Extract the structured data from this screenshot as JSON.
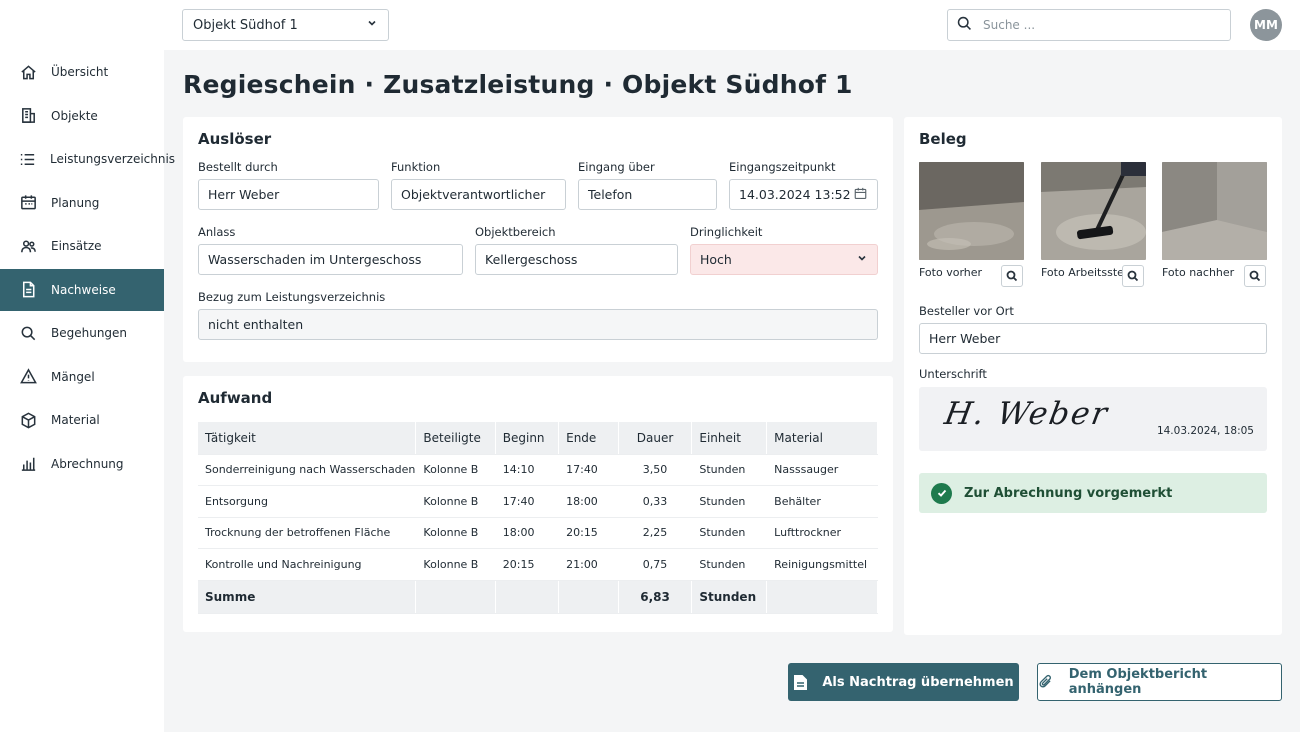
{
  "sidebar": {
    "items": [
      {
        "label": "Übersicht",
        "icon": "home-icon"
      },
      {
        "label": "Objekte",
        "icon": "building-icon"
      },
      {
        "label": "Leistungsverzeichnis",
        "icon": "list-icon"
      },
      {
        "label": "Planung",
        "icon": "calendar-icon"
      },
      {
        "label": "Einsätze",
        "icon": "team-icon"
      },
      {
        "label": "Nachweise",
        "icon": "document-icon",
        "active": true
      },
      {
        "label": "Begehungen",
        "icon": "search-icon"
      },
      {
        "label": "Mängel",
        "icon": "warning-icon"
      },
      {
        "label": "Material",
        "icon": "box-icon"
      },
      {
        "label": "Abrechnung",
        "icon": "bar-chart-icon"
      }
    ]
  },
  "topbar": {
    "object_select": "Objekt Südhof 1",
    "search_placeholder": "Suche ...",
    "avatar_initials": "MM"
  },
  "page": {
    "title": "Regieschein · Zusatzleistung · Objekt Südhof 1"
  },
  "trigger": {
    "heading": "Auslöser",
    "ordered_by_label": "Bestellt durch",
    "ordered_by_value": "Herr Weber",
    "function_label": "Funktion",
    "function_value": "Objektverantwortlicher",
    "channel_label": "Eingang über",
    "channel_value": "Telefon",
    "received_label": "Eingangszeitpunkt",
    "received_value": "14.03.2024 13:52",
    "reason_label": "Anlass",
    "reason_value": "Wasserschaden im Untergeschoss",
    "area_label": "Objektbereich",
    "area_value": "Kellergeschoss",
    "urgency_label": "Dringlichkeit",
    "urgency_value": "Hoch",
    "reference_label": "Bezug zum Leistungsverzeichnis",
    "reference_value": "nicht enthalten"
  },
  "effort": {
    "heading": "Aufwand",
    "columns": [
      "Tätigkeit",
      "Beteiligte",
      "Beginn",
      "Ende",
      "Dauer",
      "Einheit",
      "Material"
    ],
    "rows": [
      {
        "task": "Sonderreinigung nach Wasserschaden",
        "team": "Kolonne B",
        "start": "14:10",
        "end": "17:40",
        "duration": "3,50",
        "unit": "Stunden",
        "material": "Nasssauger"
      },
      {
        "task": "Entsorgung",
        "team": "Kolonne B",
        "start": "17:40",
        "end": "18:00",
        "duration": "0,33",
        "unit": "Stunden",
        "material": "Behälter"
      },
      {
        "task": "Trocknung der betroffenen Fläche",
        "team": "Kolonne B",
        "start": "18:00",
        "end": "20:15",
        "duration": "2,25",
        "unit": "Stunden",
        "material": "Lufttrockner"
      },
      {
        "task": "Kontrolle und Nachreinigung",
        "team": "Kolonne B",
        "start": "20:15",
        "end": "21:00",
        "duration": "0,75",
        "unit": "Stunden",
        "material": "Reinigungsmittel"
      }
    ],
    "sum_label": "Summe",
    "sum_duration": "6,83",
    "sum_unit": "Stunden"
  },
  "evidence": {
    "heading": "Beleg",
    "photos": [
      "Foto vorher",
      "Foto Arbeitsstelle",
      "Foto nachher"
    ],
    "orderer_label": "Besteller vor Ort",
    "orderer_value": "Herr Weber",
    "signature_label": "Unterschrift",
    "signature_text": "H. Weber",
    "signature_date": "14.03.2024, 18:05",
    "status_text": "Zur Abrechnung vorgemerkt"
  },
  "actions": {
    "primary_label": "Als Nachtrag übernehmen",
    "secondary_label": "Dem Objektbericht anhängen"
  },
  "colors": {
    "accent": "#34636f",
    "urgent_bg": "#fbe8e8",
    "success_bg": "#ddefe3",
    "success": "#1e7a4d"
  }
}
